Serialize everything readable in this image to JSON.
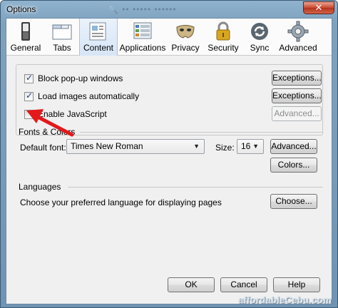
{
  "window": {
    "title": "Options",
    "background_ghost_text": "🔍 •• ••••• ••••••"
  },
  "toolbar": {
    "tabs": [
      {
        "label": "General",
        "icon": "switch-icon"
      },
      {
        "label": "Tabs",
        "icon": "tabs-window-icon"
      },
      {
        "label": "Content",
        "icon": "content-page-icon",
        "selected": true
      },
      {
        "label": "Applications",
        "icon": "applications-icon"
      },
      {
        "label": "Privacy",
        "icon": "privacy-mask-icon"
      },
      {
        "label": "Security",
        "icon": "padlock-icon"
      },
      {
        "label": "Sync",
        "icon": "sync-icon"
      },
      {
        "label": "Advanced",
        "icon": "gear-icon"
      }
    ]
  },
  "content": {
    "block_popups": {
      "label": "Block pop-up windows",
      "checked": true,
      "button": "Exceptions..."
    },
    "load_images": {
      "label": "Load images automatically",
      "checked": true,
      "button": "Exceptions..."
    },
    "javascript": {
      "label": "Enable JavaScript",
      "checked": false,
      "button": "Advanced..."
    }
  },
  "fonts": {
    "group_label": "Fonts & Colors",
    "default_font_label": "Default font:",
    "default_font_value": "Times New Roman",
    "size_label": "Size:",
    "size_value": "16",
    "advanced_button": "Advanced...",
    "colors_button": "Colors..."
  },
  "languages": {
    "group_label": "Languages",
    "description": "Choose your preferred language for displaying pages",
    "choose_button": "Choose..."
  },
  "footer": {
    "ok": "OK",
    "cancel": "Cancel",
    "help": "Help"
  },
  "watermark": "affordableCebu.com",
  "colors": {
    "annotation_arrow": "#e3191c",
    "selected_tab": "#d6e5f6"
  }
}
